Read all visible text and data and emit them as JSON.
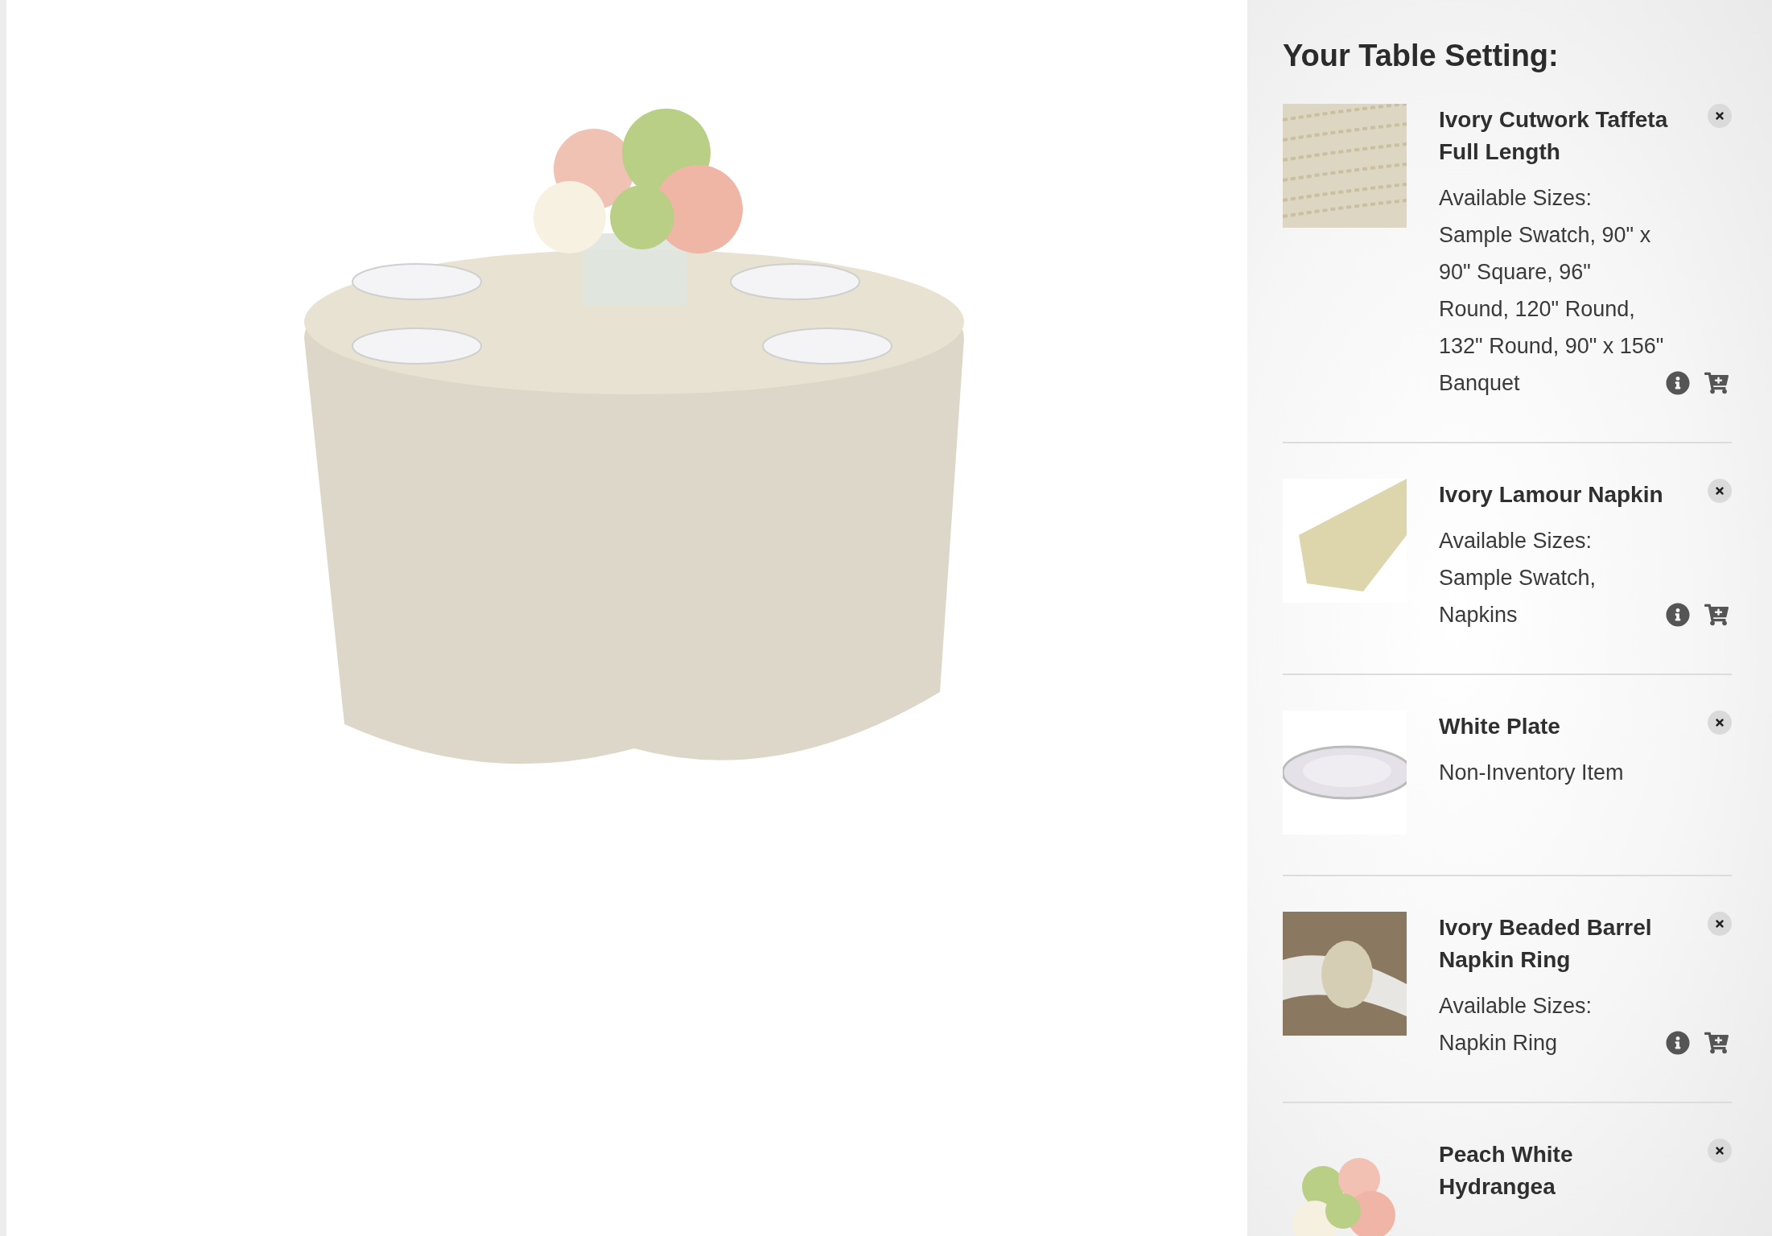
{
  "sidebar": {
    "title": "Your Table Setting:",
    "items": [
      {
        "kind": "sizes",
        "name": "Ivory Cutwork Taffeta Full Length",
        "sizes_label": "Available Sizes:",
        "sizes": "Sample Swatch, 90\" x 90\" Square, 96\" Round, 120\" Round, 132\" Round, 90\" x 156\" Banquet"
      },
      {
        "kind": "sizes",
        "name": "Ivory Lamour Napkin",
        "sizes_label": "Available Sizes:",
        "sizes": "Sample Swatch, Napkins"
      },
      {
        "kind": "note",
        "name": "White Plate",
        "note": "Non-Inventory Item"
      },
      {
        "kind": "sizes",
        "name": "Ivory Beaded Barrel Napkin Ring",
        "sizes_label": "Available Sizes:",
        "sizes": "Napkin Ring"
      },
      {
        "kind": "note",
        "name": "Peach White Hydrangea"
      }
    ]
  }
}
